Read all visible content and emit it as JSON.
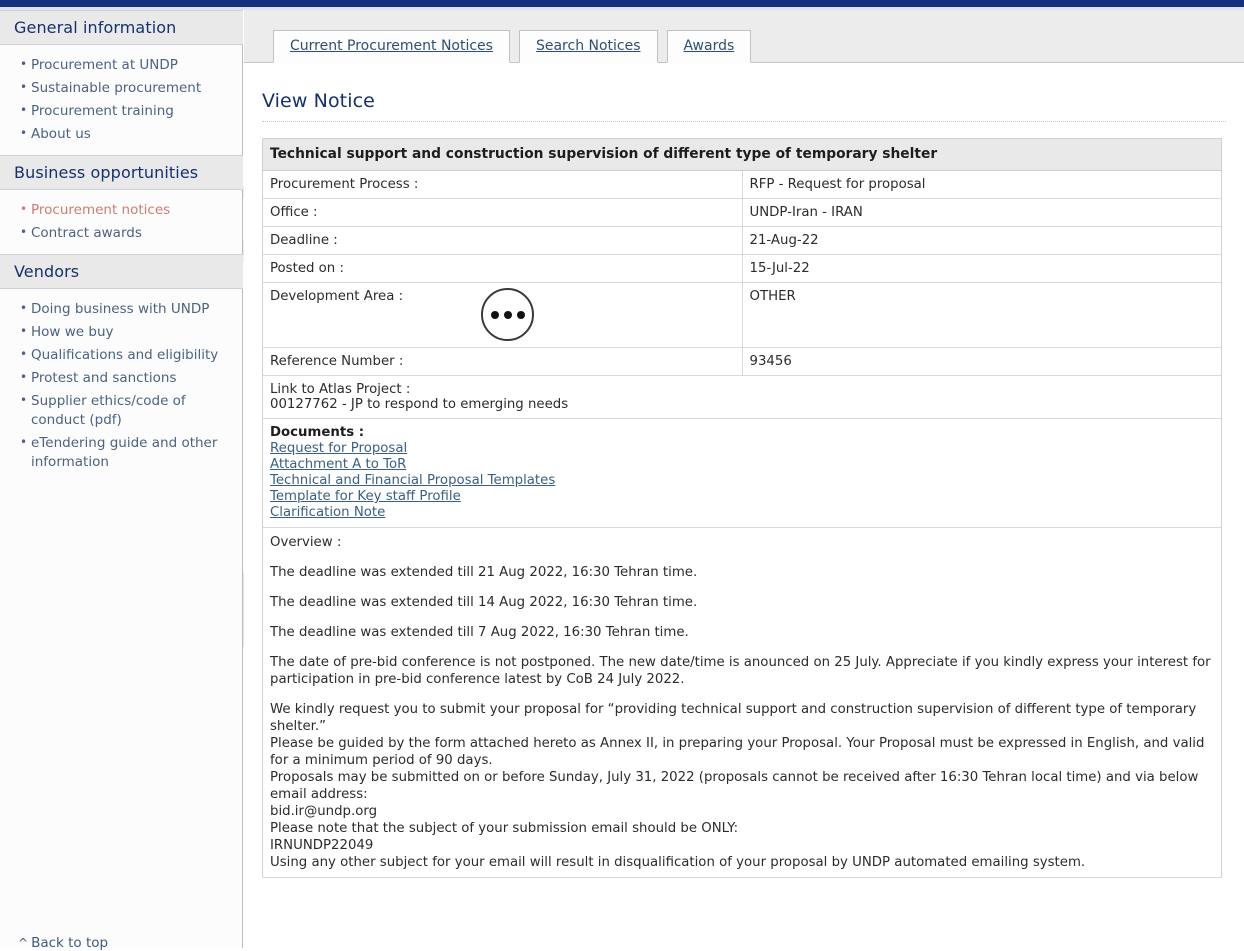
{
  "theme": {
    "top_bar_color": "#13307f",
    "header_text_color": "#14316e",
    "link_color": "#3a6085",
    "active_link_color": "#cd7d72",
    "panel_header_bg": "#e9e9e9"
  },
  "sidebar": {
    "sections": [
      {
        "heading": "General information",
        "items": [
          {
            "label": "Procurement at UNDP",
            "active": false
          },
          {
            "label": "Sustainable procurement",
            "active": false
          },
          {
            "label": "Procurement training",
            "active": false
          },
          {
            "label": "About us",
            "active": false
          }
        ]
      },
      {
        "heading": "Business opportunities",
        "items": [
          {
            "label": "Procurement notices",
            "active": true
          },
          {
            "label": "Contract awards",
            "active": false
          }
        ]
      },
      {
        "heading": "Vendors",
        "items": [
          {
            "label": "Doing business with UNDP",
            "active": false
          },
          {
            "label": "How we buy",
            "active": false
          },
          {
            "label": "Qualifications and eligibility",
            "active": false
          },
          {
            "label": "Protest and sanctions",
            "active": false
          },
          {
            "label": "Supplier ethics/code of conduct (pdf)",
            "active": false
          },
          {
            "label": "eTendering guide and other information",
            "active": false
          }
        ]
      }
    ],
    "back_to_top": "Back to top",
    "back_to_top_caret": "^"
  },
  "tabs": [
    {
      "label": "Current Procurement Notices"
    },
    {
      "label": "Search Notices"
    },
    {
      "label": "Awards"
    }
  ],
  "page": {
    "title": "View Notice"
  },
  "notice": {
    "title": "Technical support and construction supervision of different type of temporary shelter",
    "fields": [
      {
        "label": "Procurement Process :",
        "value": "RFP - Request for proposal"
      },
      {
        "label": "Office :",
        "value": "UNDP-Iran - IRAN"
      },
      {
        "label": "Deadline :",
        "value": "21-Aug-22"
      },
      {
        "label": "Posted on :",
        "value": "15-Jul-22"
      },
      {
        "label": "Development Area :",
        "value": "OTHER"
      },
      {
        "label": "Reference Number :",
        "value": "93456"
      }
    ],
    "atlas": {
      "label": "Link to Atlas Project :",
      "value": "00127762 - JP to respond to emerging needs"
    },
    "documents": {
      "label": "Documents :",
      "links": [
        "Request for Proposal",
        "Attachment A to ToR",
        "Technical and Financial Proposal Templates",
        "Template for Key staff Profile",
        "Clarification Note"
      ]
    },
    "overview": {
      "label": "Overview :",
      "paragraphs": [
        "The deadline was extended till 21 Aug 2022, 16:30 Tehran time.",
        "The deadline was extended till 14 Aug 2022, 16:30 Tehran time.",
        "The deadline was extended till 7 Aug 2022, 16:30 Tehran time.",
        "The date of pre-bid conference is not postponed. The new date/time is anounced on 25 July. Appreciate if you kindly express your interest for participation in pre-bid conference latest by CoB 24 July 2022."
      ],
      "closing_lines": [
        "We kindly request you to submit your proposal for “providing technical support and construction supervision of different type of temporary shelter.”",
        "Please be guided by the form attached hereto as Annex II, in preparing your Proposal. Your Proposal must be expressed in English, and valid for a minimum period of 90 days.",
        "Proposals may be submitted on or before Sunday, July 31, 2022 (proposals cannot be received after 16:30 Tehran local time) and via below email address:",
        "bid.ir@undp.org",
        "Please note that the subject of your submission email should be ONLY:",
        "IRNUNDP22049",
        "Using any other subject for your email will result in disqualification of your proposal by UNDP automated emailing system."
      ]
    }
  }
}
